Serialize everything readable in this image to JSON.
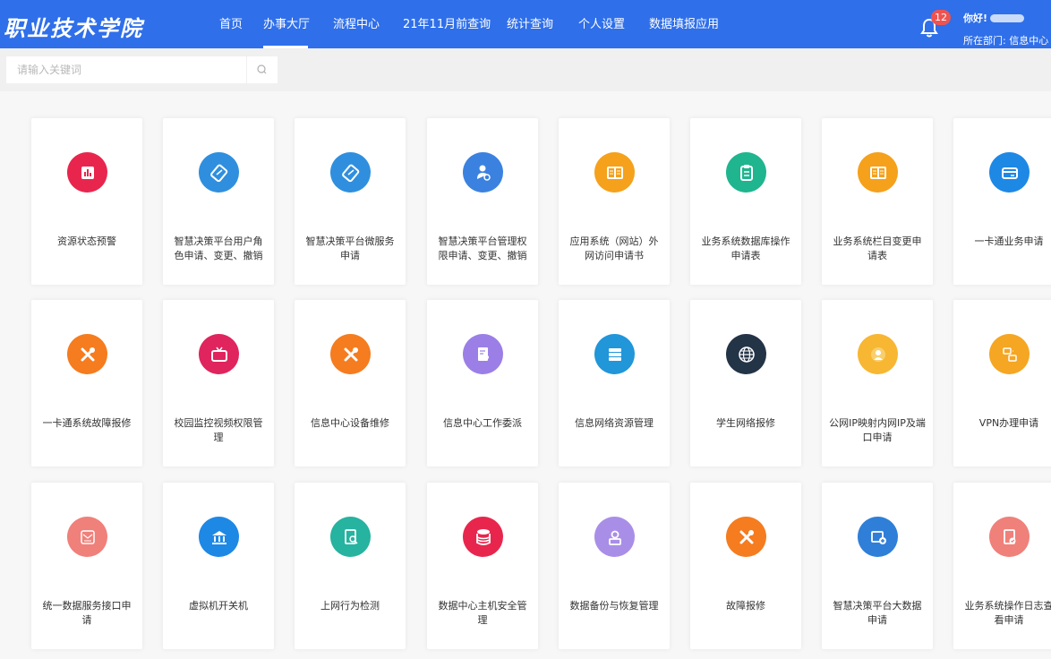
{
  "header": {
    "logo_text": "职业技术学院",
    "nav": [
      {
        "label": "首页",
        "active": false
      },
      {
        "label": "办事大厅",
        "active": true
      },
      {
        "label": "流程中心",
        "active": false
      },
      {
        "label": "21年11月前查询",
        "active": false
      },
      {
        "label": "统计查询",
        "active": false
      },
      {
        "label": "个人设置",
        "active": false
      },
      {
        "label": "数据填报应用",
        "active": false
      }
    ],
    "notification_count": "12",
    "greeting": "你好!",
    "department": "所在部门: 信息中心"
  },
  "search": {
    "placeholder": "请输入关键词"
  },
  "services": [
    {
      "label": "资源状态预警",
      "icon": "bar-chart-icon",
      "color": "#e8264d"
    },
    {
      "label": "智慧决策平台用户角色申请、变更、撤销",
      "icon": "ticket-icon",
      "color": "#2f8fde"
    },
    {
      "label": "智慧决策平台微服务申请",
      "icon": "ticket-icon",
      "color": "#2f8fde"
    },
    {
      "label": "智慧决策平台管理权限申请、变更、撤销",
      "icon": "user-settings-icon",
      "color": "#3b82e0"
    },
    {
      "label": "应用系统（网站）外网访问申请书",
      "icon": "book-icon",
      "color": "#f5a11c"
    },
    {
      "label": "业务系统数据库操作申请表",
      "icon": "clipboard-icon",
      "color": "#1fb58f"
    },
    {
      "label": "业务系统栏目变更申请表",
      "icon": "book-icon",
      "color": "#f5a11c"
    },
    {
      "label": "一卡通业务申请",
      "icon": "card-icon",
      "color": "#1e88e5"
    },
    {
      "label": "一卡通系统故障报修",
      "icon": "tools-icon",
      "color": "#f57c1f"
    },
    {
      "label": "校园监控视频权限管理",
      "icon": "tv-icon",
      "color": "#e0245e"
    },
    {
      "label": "信息中心设备维修",
      "icon": "tools-icon",
      "color": "#f57c1f"
    },
    {
      "label": "信息中心工作委派",
      "icon": "document-user-icon",
      "color": "#9b7fe6"
    },
    {
      "label": "信息网络资源管理",
      "icon": "server-icon",
      "color": "#2196d9"
    },
    {
      "label": "学生网络报修",
      "icon": "globe-icon",
      "color": "#243447"
    },
    {
      "label": "公网IP映射内网IP及端口申请",
      "icon": "clock-user-icon",
      "color": "#f7b733"
    },
    {
      "label": "VPN办理申请",
      "icon": "vpn-icon",
      "color": "#f5a623"
    },
    {
      "label": "统一数据服务接口申请",
      "icon": "interface-icon",
      "color": "#f0807a"
    },
    {
      "label": "虚拟机开关机",
      "icon": "bank-icon",
      "color": "#1e88e5"
    },
    {
      "label": "上网行为检测",
      "icon": "search-document-icon",
      "color": "#26b3a0"
    },
    {
      "label": "数据中心主机安全管理",
      "icon": "database-icon",
      "color": "#e8264d"
    },
    {
      "label": "数据备份与恢复管理",
      "icon": "user-backup-icon",
      "color": "#a98ee8"
    },
    {
      "label": "故障报修",
      "icon": "tools-icon",
      "color": "#f57c1f"
    },
    {
      "label": "智慧决策平台大数据申请",
      "icon": "data-apply-icon",
      "color": "#2f7fd8"
    },
    {
      "label": "业务系统操作日志查看申请",
      "icon": "log-check-icon",
      "color": "#f0807a"
    }
  ]
}
